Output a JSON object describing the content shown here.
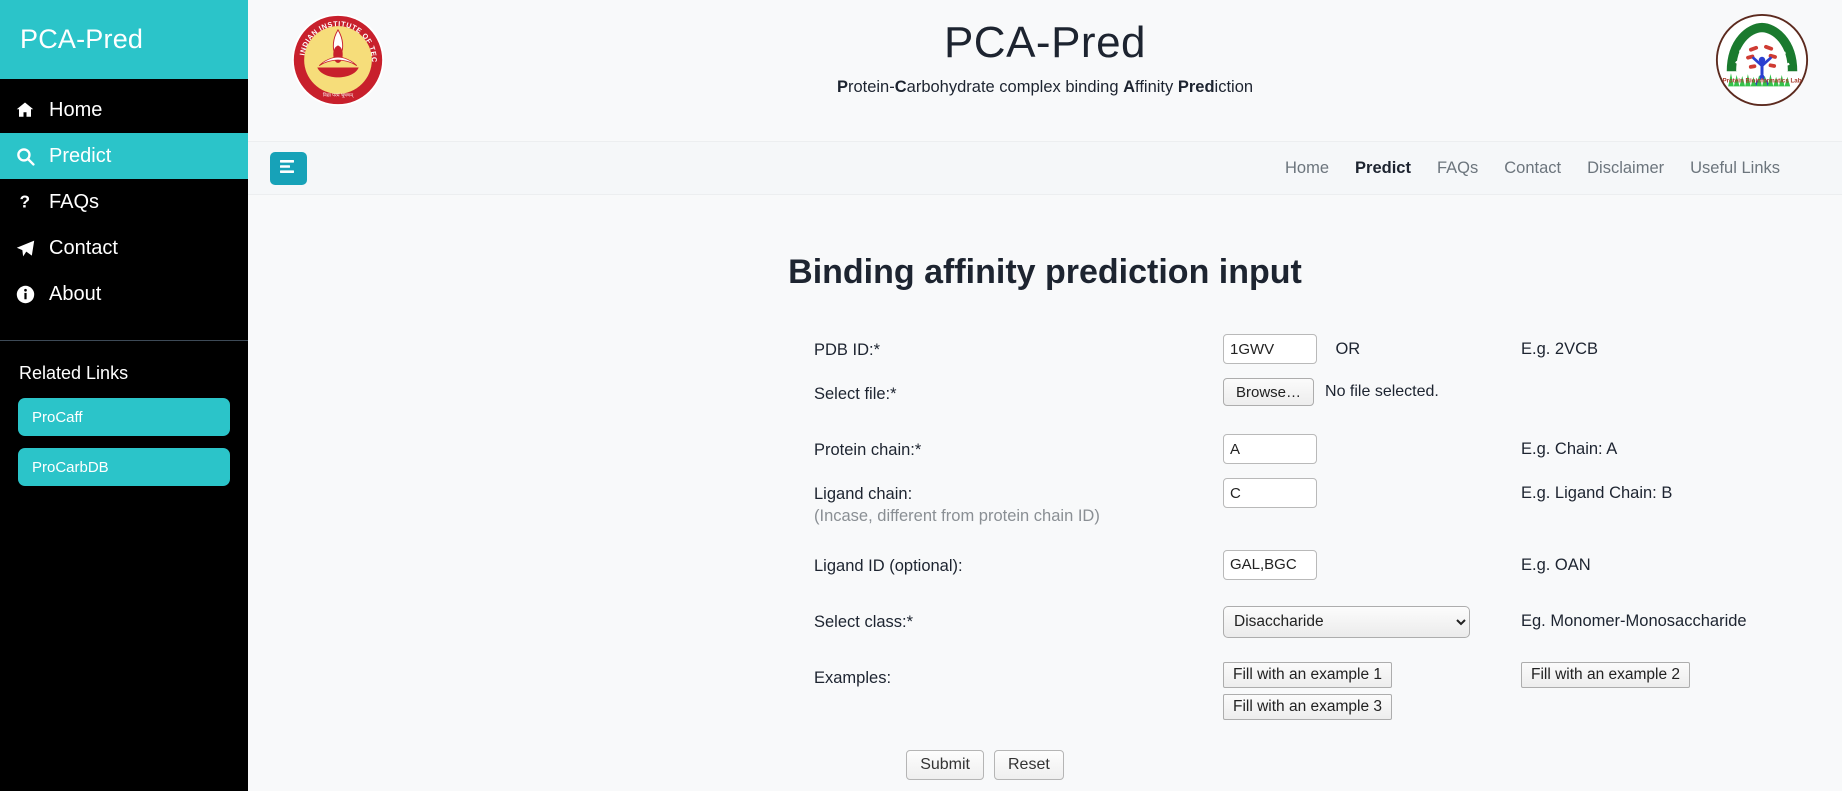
{
  "sidebar": {
    "brand": "PCA-Pred",
    "items": [
      {
        "label": "Home",
        "icon": "home-icon",
        "active": false
      },
      {
        "label": "Predict",
        "icon": "search-icon",
        "active": true
      },
      {
        "label": "FAQs",
        "icon": "question-icon",
        "active": false
      },
      {
        "label": "Contact",
        "icon": "paper-plane-icon",
        "active": false
      },
      {
        "label": "About",
        "icon": "info-icon",
        "active": false
      }
    ],
    "related_links_title": "Related Links",
    "related_links": [
      {
        "label": "ProCaff"
      },
      {
        "label": "ProCarbDB"
      }
    ],
    "accent_color": "#2bc4c9",
    "background_color": "#000000"
  },
  "header": {
    "title": "PCA-Pred",
    "subtitle_parts": [
      {
        "text": "P",
        "bold": true
      },
      {
        "text": "rotein-",
        "bold": false
      },
      {
        "text": "C",
        "bold": true
      },
      {
        "text": "arbohydrate complex binding ",
        "bold": false
      },
      {
        "text": "A",
        "bold": true
      },
      {
        "text": "ffinity ",
        "bold": false
      },
      {
        "text": "Pred",
        "bold": true
      },
      {
        "text": "iction",
        "bold": false
      }
    ],
    "subtitle_plain": "Protein-Carbohydrate complex binding Affinity Prediction",
    "logo_left": "iit-madras-logo",
    "logo_left_text": "INDIAN INSTITUTE OF TECHNOLOGY MADRAS",
    "logo_right": "protein-bioinformatics-lab-logo",
    "logo_right_text": "Protein Bioinformatics Lab"
  },
  "navbar": {
    "toggle_icon": "align-left-icon",
    "links": [
      {
        "label": "Home",
        "current": false
      },
      {
        "label": "Predict",
        "current": true
      },
      {
        "label": "FAQs",
        "current": false
      },
      {
        "label": "Contact",
        "current": false
      },
      {
        "label": "Disclaimer",
        "current": false
      },
      {
        "label": "Useful Links",
        "current": false
      }
    ]
  },
  "main": {
    "page_title": "Binding affinity prediction input",
    "fields": {
      "pdb_id": {
        "label": "PDB ID:*",
        "value": "1GWV",
        "or_text": "OR",
        "hint": "E.g. 2VCB"
      },
      "select_file": {
        "label": "Select file:*",
        "browse_label": "Browse…",
        "file_status": "No file selected.",
        "hint": ""
      },
      "protein_chain": {
        "label": "Protein chain:*",
        "value": "A",
        "hint": "E.g. Chain: A"
      },
      "ligand_chain": {
        "label": "Ligand chain:",
        "sub_label": "(Incase, different from protein chain ID)",
        "value": "C",
        "hint": "E.g. Ligand Chain: B"
      },
      "ligand_id": {
        "label": "Ligand ID (optional):",
        "value": "GAL,BGC",
        "hint": "E.g. OAN"
      },
      "select_class": {
        "label": "Select class:*",
        "selected": "Disaccharide",
        "options": [
          "Disaccharide"
        ],
        "hint": "Eg. Monomer-Monosaccharide"
      },
      "examples": {
        "label": "Examples:",
        "buttons": [
          "Fill with an example 1",
          "Fill with an example 2",
          "Fill with an example 3"
        ]
      }
    },
    "actions": {
      "submit_label": "Submit",
      "reset_label": "Reset"
    }
  }
}
